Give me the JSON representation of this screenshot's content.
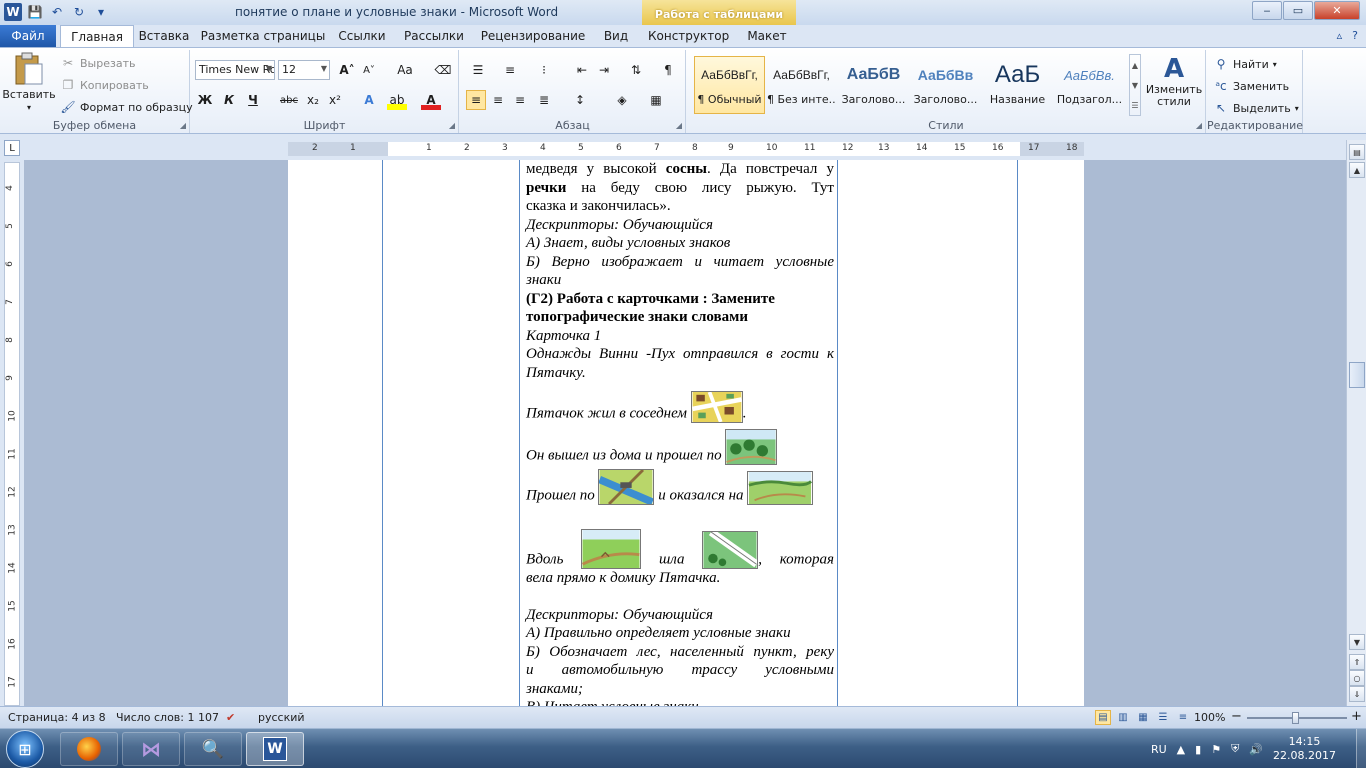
{
  "window": {
    "title": "понятие о плане и условные знаки  -  Microsoft Word",
    "context_tab_header": "Работа с таблицами",
    "min_label": "‒",
    "max_label": "▭",
    "close_label": "✕"
  },
  "qat": {
    "save": "💾",
    "undo": "↶",
    "redo": "↻",
    "more": "▾"
  },
  "tabs": {
    "file": "Файл",
    "items": [
      "Главная",
      "Вставка",
      "Разметка страницы",
      "Ссылки",
      "Рассылки",
      "Рецензирование",
      "Вид",
      "Конструктор",
      "Макет"
    ]
  },
  "ribbon": {
    "clipboard": {
      "paste": "Вставить",
      "cut": "Вырезать",
      "copy": "Копировать",
      "format_painter": "Формат по образцу",
      "label": "Буфер обмена"
    },
    "font": {
      "font_name": "Times New Ro",
      "font_size": "12",
      "bold": "Ж",
      "italic": "К",
      "underline": "Ч",
      "strike": "abc",
      "subscript": "x₂",
      "superscript": "x²",
      "grow": "A˄",
      "shrink": "A˅",
      "change_case": "Aa",
      "label": "Шрифт"
    },
    "paragraph": {
      "label": "Абзац"
    },
    "styles": {
      "items": [
        {
          "sample": "АаБбВвГг,",
          "name": "¶ Обычный"
        },
        {
          "sample": "АаБбВвГг,",
          "name": "¶ Без инте..."
        },
        {
          "sample": "АаБбВ",
          "name": "Заголово..."
        },
        {
          "sample": "АаБбВв",
          "name": "Заголово..."
        },
        {
          "sample": "АаБ",
          "name": "Название"
        },
        {
          "sample": "АаБбВв.",
          "name": "Подзагол..."
        }
      ],
      "change_styles": "Изменить стили",
      "label": "Стили"
    },
    "editing": {
      "find": "Найти",
      "replace": "Заменить",
      "select": "Выделить",
      "label": "Редактирование"
    }
  },
  "ruler": {
    "marks": [
      "2",
      "1",
      "1",
      "2",
      "3",
      "4",
      "5",
      "6",
      "7",
      "8",
      "9",
      "10",
      "11",
      "12",
      "13",
      "14",
      "15",
      "16",
      "17",
      "18"
    ],
    "vmarks": [
      "4",
      "5",
      "6",
      "7",
      "8",
      "9",
      "10",
      "11",
      "12",
      "13",
      "14",
      "15",
      "16",
      "17"
    ]
  },
  "doc": {
    "l1a": "медведя у высокой ",
    "l1b": "сосны",
    "l1c": ". Да повстречал у",
    "l2a": "речки",
    "l2b": " на беду свою лису рыжую. Тут",
    "l3": "сказка и закончилась».",
    "d1": "Дескрипторы:  Обучающийся",
    "d2": "А) Знает, виды условных знаков",
    "d3a": "Б) Верно изображает и читает условные",
    "d3b": "знаки",
    "h1": "(Г2) Работа с карточками : Замените",
    "h2": "топографические знаки  словами",
    "card": "Карточка 1",
    "s1a": "Однажды Винни -Пух отправился в гости к",
    "s1b": "Пятачку.",
    "s2": "Пятачок жил в соседнем",
    "s3": "Он вышел из дома и прошел по",
    "s4a": "Прошел по",
    "s4b": "и оказался на",
    "s5a": " Вдоль",
    "s5b": "шла",
    "s5c": ", которая",
    "s5d": "вела прямо к домику Пятачка.",
    "e1": " Дескрипторы:  Обучающийся",
    "e2": "А) Правильно определяет условные знаки",
    "e3a": "Б) Обозначает лес, населенный пункт, реку",
    "e3b": "и   автомобильную   трассу    условными",
    "e3c": "знаками;",
    "e4": "В) Читает условные знаки"
  },
  "status": {
    "page": "Страница: 4 из 8",
    "words": "Число слов: 1 107",
    "lang": "русский",
    "zoom": "100%",
    "zoom_minus": "−",
    "zoom_plus": "+"
  },
  "taskbar": {
    "lang": "RU",
    "time": "14:15",
    "date": "22.08.2017"
  }
}
